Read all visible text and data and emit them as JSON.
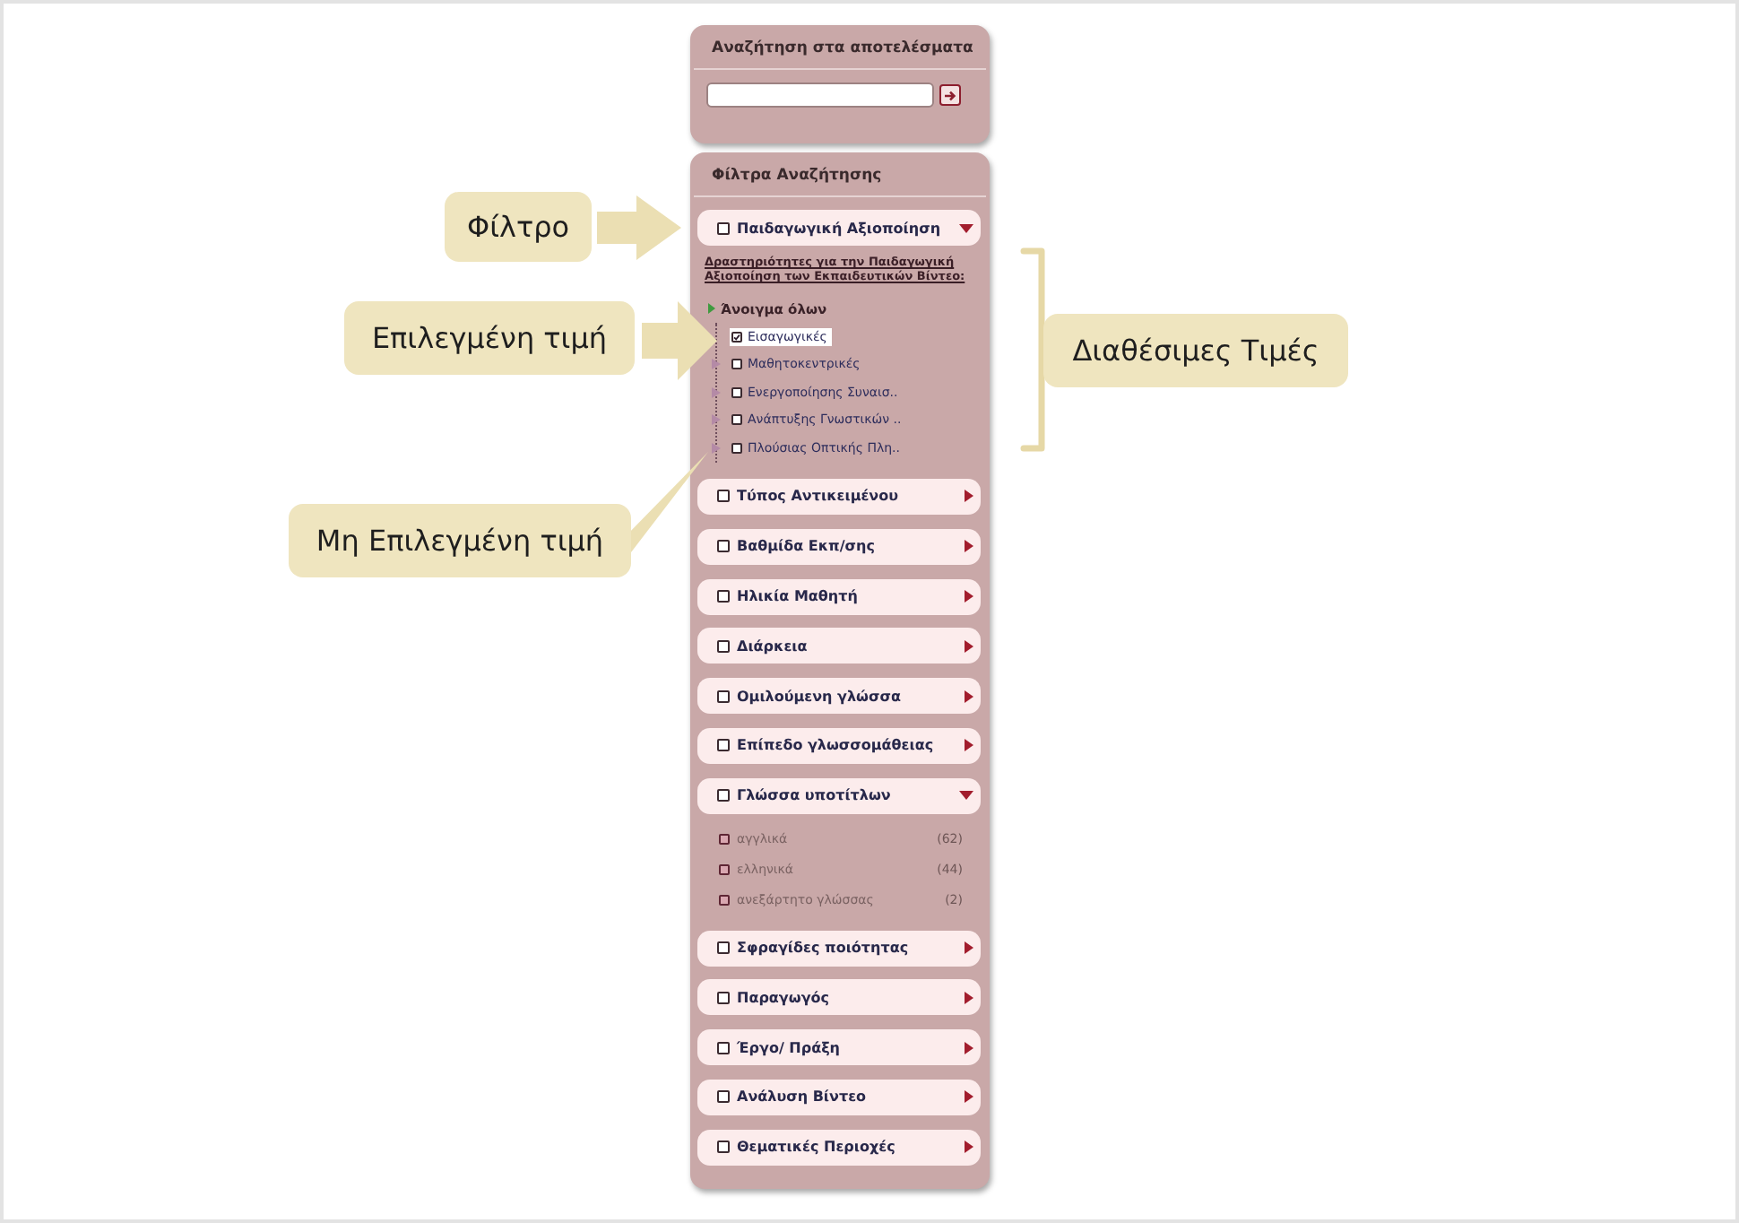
{
  "search_panel": {
    "title": "Αναζήτηση στα αποτελέσματα"
  },
  "filter_panel": {
    "title": "Φίλτρα Αναζήτησης",
    "filters": [
      {
        "label": "Παιδαγωγική Αξιοποίηση",
        "checked": false,
        "expanded": true,
        "body": {
          "kind": "tree",
          "description": "Δραστηριότητες για την Παιδαγωγική Αξιοποίηση των Εκπαιδευτικών Βίντεο:",
          "expand_all": "Άνοιγμα όλων",
          "values": [
            {
              "label": "Εισαγωγικές",
              "checked": true,
              "selected": true,
              "expandable": false
            },
            {
              "label": "Μαθητοκεντρικές",
              "checked": false,
              "selected": false,
              "expandable": true
            },
            {
              "label": "Ενεργοποίησης Συναισ..",
              "checked": false,
              "selected": false,
              "expandable": true
            },
            {
              "label": "Ανάπτυξης Γνωστικών ..",
              "checked": false,
              "selected": false,
              "expandable": true
            },
            {
              "label": "Πλούσιας Οπτικής Πλη..",
              "checked": false,
              "selected": false,
              "expandable": true
            }
          ]
        }
      },
      {
        "label": "Τύπος Αντικειμένου",
        "checked": false,
        "expanded": false
      },
      {
        "label": "Βαθμίδα Εκπ/σης",
        "checked": false,
        "expanded": false
      },
      {
        "label": "Ηλικία Μαθητή",
        "checked": false,
        "expanded": false
      },
      {
        "label": "Διάρκεια",
        "checked": false,
        "expanded": false
      },
      {
        "label": "Ομιλούμενη γλώσσα",
        "checked": false,
        "expanded": false
      },
      {
        "label": "Επίπεδο γλωσσομάθειας",
        "checked": false,
        "expanded": false
      },
      {
        "label": "Γλώσσα υποτίτλων",
        "checked": false,
        "expanded": true,
        "body": {
          "kind": "list",
          "values": [
            {
              "label": "αγγλικά",
              "count": "(62)",
              "checked": false
            },
            {
              "label": "ελληνικά",
              "count": "(44)",
              "checked": false
            },
            {
              "label": "ανεξάρτητο γλώσσας",
              "count": "(2)",
              "checked": false
            }
          ]
        }
      },
      {
        "label": "Σφραγίδες ποιότητας",
        "checked": false,
        "expanded": false
      },
      {
        "label": "Παραγωγός",
        "checked": false,
        "expanded": false
      },
      {
        "label": "Έργο/ Πράξη",
        "checked": false,
        "expanded": false
      },
      {
        "label": "Ανάλυση Βίντεο",
        "checked": false,
        "expanded": false
      },
      {
        "label": "Θεματικές Περιοχές",
        "checked": false,
        "expanded": false
      }
    ]
  },
  "annotations": [
    {
      "kind": "arrow",
      "text": "Φίλτρο"
    },
    {
      "kind": "arrow",
      "text": "Επιλεγμένη τιμή"
    },
    {
      "kind": "bracket",
      "text": "Διαθέσιμες Τιμές"
    },
    {
      "kind": "pointer",
      "text": "Μη Επιλεγμένη τιμή"
    }
  ]
}
